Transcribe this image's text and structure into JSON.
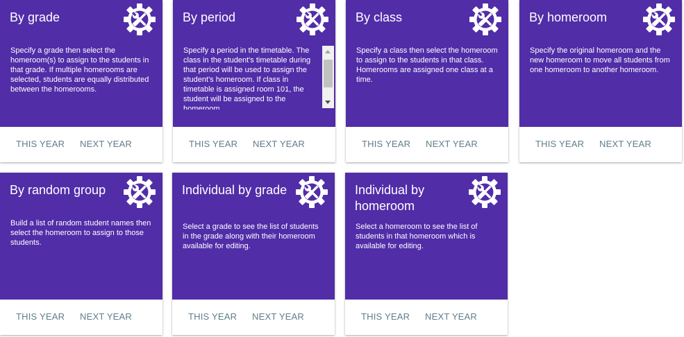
{
  "accent_color": "#512da8",
  "action_text_color": "#607d8b",
  "cards": [
    {
      "title": "By grade",
      "icon": "settings-tools-icon",
      "description": "Specify a grade then select the homeroom(s) to assign to the students in that grade. If multiple homerooms are selected, students are equally distributed between the homerooms.",
      "this_year_label": "THIS YEAR",
      "next_year_label": "NEXT YEAR"
    },
    {
      "title": "By period",
      "icon": "settings-tools-icon",
      "description": "Specify a period in the timetable. The class in the student's timetable during that period will be used to assign the student's homeroom. If class in timetable is assigned room 101, the student will be assigned to the homeroom",
      "this_year_label": "THIS YEAR",
      "next_year_label": "NEXT YEAR"
    },
    {
      "title": "By class",
      "icon": "settings-tools-icon",
      "description": "Specify a class then select the homeroom to assign to the students in that class. Homerooms are assigned one class at a time.",
      "this_year_label": "THIS YEAR",
      "next_year_label": "NEXT YEAR"
    },
    {
      "title": "By homeroom",
      "icon": "settings-tools-icon",
      "description": "Specify the original homeroom and the new homeroom to move all students from one homeroom to another homeroom.",
      "this_year_label": "THIS YEAR",
      "next_year_label": "NEXT YEAR"
    },
    {
      "title": "By random group",
      "icon": "settings-tools-icon",
      "description": "Build a list of random student names then select the homeroom to assign to those students.",
      "this_year_label": "THIS YEAR",
      "next_year_label": "NEXT YEAR"
    },
    {
      "title": "Individual by grade",
      "icon": "settings-tools-icon",
      "description": "Select a grade to see the list of students in the grade along with their homeroom available for editing.",
      "this_year_label": "THIS YEAR",
      "next_year_label": "NEXT YEAR"
    },
    {
      "title": "Individual by homeroom",
      "icon": "settings-tools-icon",
      "description": "Select a homeroom to see the list of students in that homeroom which is available for editing.",
      "this_year_label": "THIS YEAR",
      "next_year_label": "NEXT YEAR"
    }
  ]
}
